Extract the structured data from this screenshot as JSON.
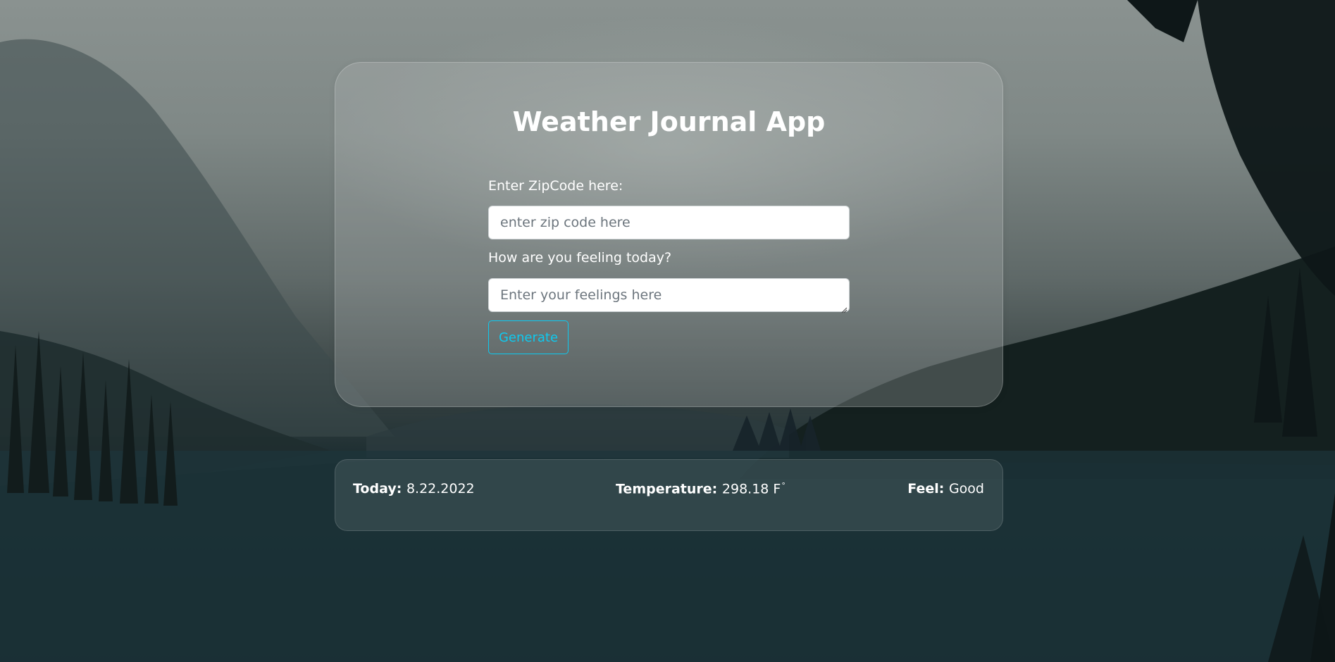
{
  "app": {
    "title": "Weather Journal App"
  },
  "form": {
    "zip_label": "Enter ZipCode here:",
    "zip_placeholder": "enter zip code here",
    "zip_value": "",
    "feelings_label": "How are you feeling today?",
    "feelings_placeholder": "Enter your feelings here",
    "feelings_value": "",
    "generate_label": "Generate"
  },
  "results": {
    "date_label": "Today:",
    "date_value": "8.22.2022",
    "temp_label": "Temperature:",
    "temp_value": "298.18 F",
    "temp_degree": "°",
    "feel_label": "Feel:",
    "feel_value": "Good"
  },
  "colors": {
    "accent": "#0dcaf0",
    "text": "#ffffff"
  },
  "icons": {
    "resize_handle": "textarea-resize-grip-icon"
  }
}
